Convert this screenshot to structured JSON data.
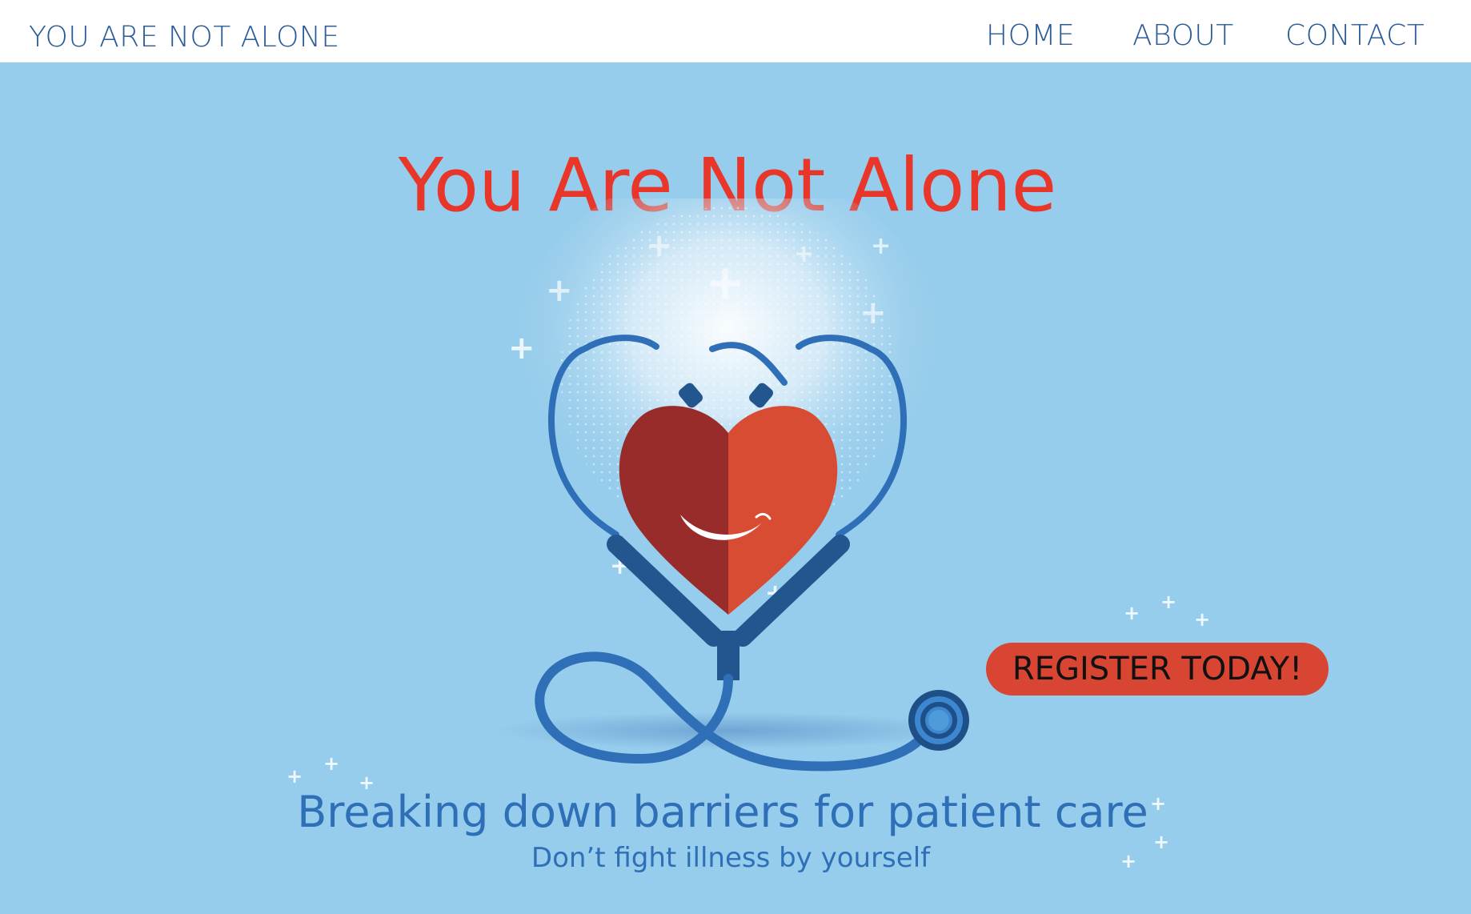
{
  "header": {
    "brand": "YOU ARE NOT ALONE",
    "nav": {
      "home": "HOME",
      "about": "ABOUT",
      "contact": "CONTACT"
    }
  },
  "hero": {
    "title": "You Are Not Alone",
    "cta_label": "REGISTER TODAY!",
    "tagline": "Breaking down barriers for patient care",
    "subtagline": "Don’t fight illness by yourself",
    "illustration": "heart-stethoscope-illustration"
  },
  "colors": {
    "hero_bg": "#97cdec",
    "title_red": "#e8372a",
    "nav_blue": "#2a5b95",
    "tagline_blue": "#2f6fb7",
    "cta_red": "#d84532",
    "heart_dark": "#972c2b",
    "heart_light": "#d84c33",
    "stethoscope": "#2f6fb7",
    "stethoscope_dark": "#23558f"
  }
}
